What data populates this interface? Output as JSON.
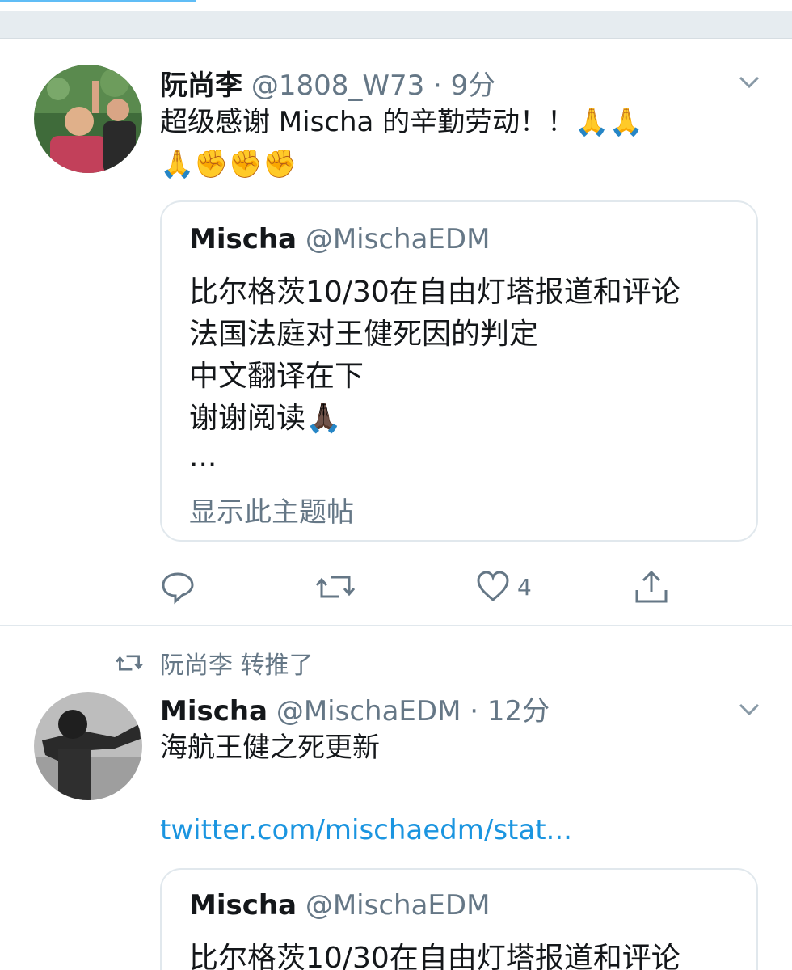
{
  "tweet1": {
    "name": "阮尚李",
    "handle": "@1808_W73",
    "time": "· 9分",
    "text_line1": "超级感谢 Mischa 的辛勤劳动！！🙏🙏",
    "text_line2": "🙏✊✊✊",
    "quote": {
      "name": "Mischa",
      "handle": "@MischaEDM",
      "lines": [
        "比尔格茨10/30在自由灯塔报道和评论",
        "法国法庭对王健死因的判定",
        "中文翻译在下",
        "谢谢阅读🙏🏿",
        "..."
      ],
      "show_thread": "显示此主题帖"
    },
    "likes": "4"
  },
  "retweet_label": "阮尚李 转推了",
  "tweet2": {
    "name": "Mischa",
    "handle": "@MischaEDM",
    "time": "· 12分",
    "text": "海航王健之死更新",
    "link": "twitter.com/mischaedm/stat...",
    "quote": {
      "name": "Mischa",
      "handle": "@MischaEDM",
      "line1": "比尔格茨10/30在自由灯塔报道和评论"
    }
  },
  "colors": {
    "accent": "#1da1f2",
    "link": "#1b95e0",
    "muted": "#657786",
    "border": "#e1e8ed"
  },
  "icons": [
    "chevron-down-icon",
    "reply-icon",
    "retweet-icon",
    "like-icon",
    "share-icon"
  ]
}
